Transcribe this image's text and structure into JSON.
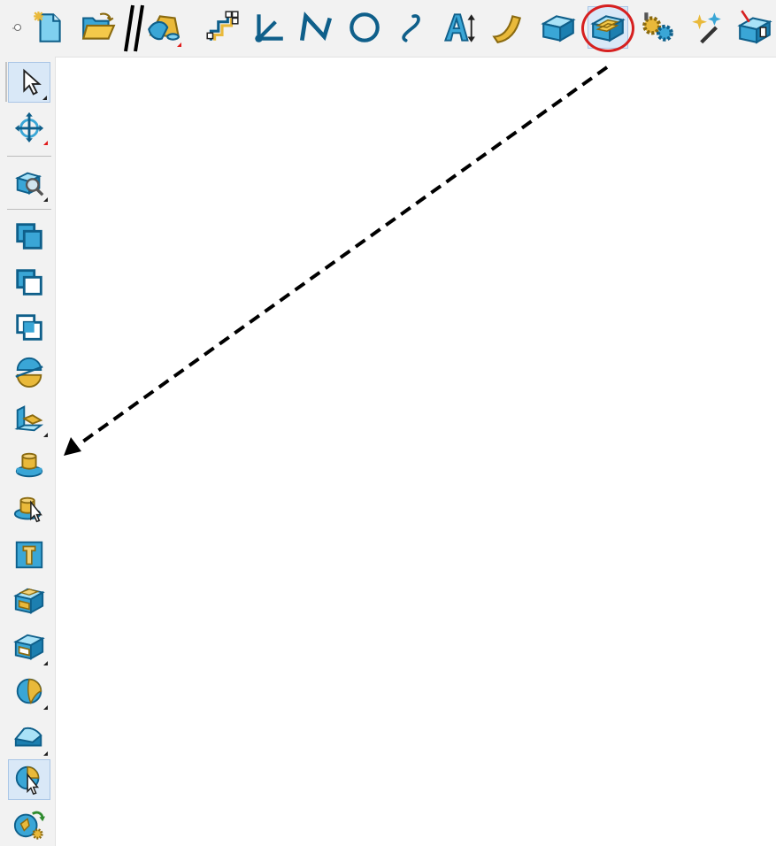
{
  "colors": {
    "toolbar_bg": "#f2f2f2",
    "icon_blue": "#3aa6d6",
    "icon_blue_dark": "#0f5f8a",
    "icon_gold": "#e9b93a",
    "selected_bg": "#d9e8f7",
    "highlight_ring": "#d62020",
    "guide_arrow": "#000000"
  },
  "top_toolbar": {
    "tools": [
      {
        "name": "new-file-icon",
        "selected": false
      },
      {
        "name": "open-folder-icon",
        "selected": false
      },
      {
        "name": "cad-import-icon",
        "selected": false
      },
      {
        "name": "sketch-profile-icon",
        "selected": false
      },
      {
        "name": "coordinate-axes-icon",
        "selected": false
      },
      {
        "name": "polyline-icon",
        "selected": false
      },
      {
        "name": "circle-icon",
        "selected": false
      },
      {
        "name": "spline-curve-icon",
        "selected": false
      },
      {
        "name": "text-letter-a-icon",
        "selected": false
      },
      {
        "name": "surface-patch-icon",
        "selected": false
      },
      {
        "name": "solid-block-icon",
        "selected": false
      },
      {
        "name": "feature-block-icon",
        "selected": true
      },
      {
        "name": "gear-tools-icon",
        "selected": false
      },
      {
        "name": "magic-wand-icon",
        "selected": false
      },
      {
        "name": "usb-export-icon",
        "selected": false
      }
    ]
  },
  "left_toolbar": {
    "tools": [
      {
        "name": "select-arrow-icon",
        "selected": true
      },
      {
        "name": "transform-move-icon",
        "selected": false
      },
      {
        "name": "zoom-view-icon",
        "selected": false
      },
      {
        "name": "boolean-union-icon",
        "selected": false
      },
      {
        "name": "boolean-subtract-icon",
        "selected": false
      },
      {
        "name": "boolean-intersect-icon",
        "selected": false
      },
      {
        "name": "split-solid-icon",
        "selected": false
      },
      {
        "name": "extrude-solid-icon",
        "selected": false
      },
      {
        "name": "boss-feature-icon",
        "selected": false
      },
      {
        "name": "boss-select-icon",
        "selected": false
      },
      {
        "name": "hole-feature-icon",
        "selected": false
      },
      {
        "name": "pocket-feature-icon",
        "selected": false
      },
      {
        "name": "slot-feature-icon",
        "selected": false
      },
      {
        "name": "blend-sphere-icon",
        "selected": false
      },
      {
        "name": "chamfer-fillet-icon",
        "selected": false
      },
      {
        "name": "select-feature-icon",
        "selected": true
      },
      {
        "name": "replay-feature-icon",
        "selected": false
      }
    ]
  }
}
